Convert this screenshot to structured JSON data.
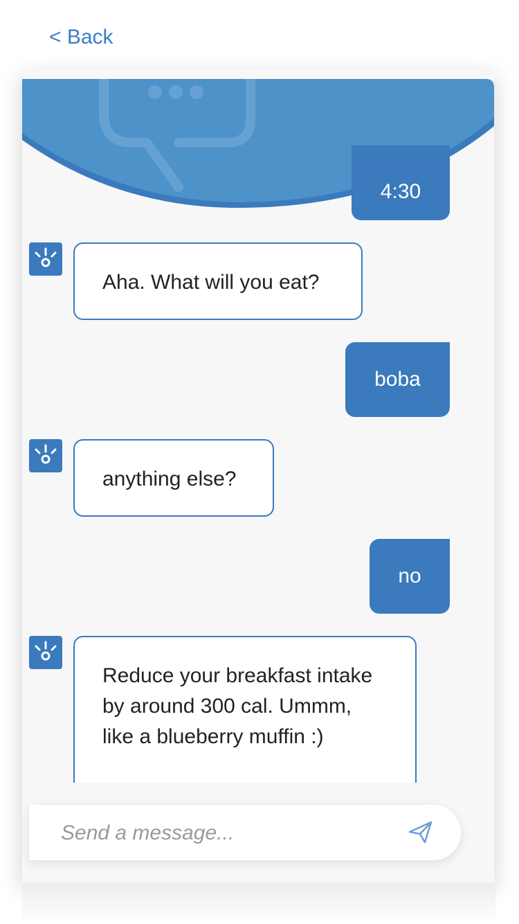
{
  "nav": {
    "back_label": "< Back"
  },
  "chat": {
    "messages": [
      {
        "from": "user",
        "text": "4:30"
      },
      {
        "from": "bot",
        "text": "Aha. What will you eat?"
      },
      {
        "from": "user",
        "text": "boba"
      },
      {
        "from": "bot",
        "text": "anything else?"
      },
      {
        "from": "user",
        "text": "no"
      },
      {
        "from": "bot",
        "text": "Reduce your breakfast intake by around 300 cal. Ummm, like a blueberry muffin :)"
      }
    ]
  },
  "composer": {
    "placeholder": "Send a message...",
    "send_icon": "paper-plane-icon"
  },
  "colors": {
    "accent": "#3a7abd",
    "link": "#3a7dc9",
    "header": "#4d92c9",
    "background": "#f7f7f7"
  },
  "icons": {
    "bot_avatar": "bot-logo-icon",
    "header_decoration": "chat-bubble-icon"
  }
}
